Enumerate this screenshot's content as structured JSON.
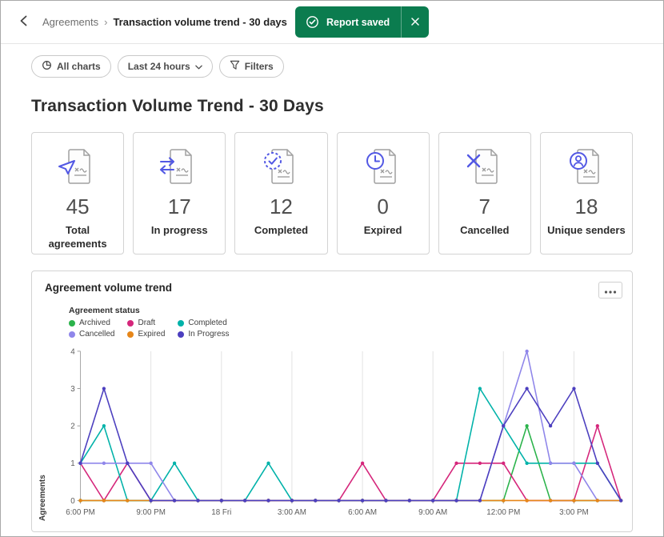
{
  "header": {
    "breadcrumb": {
      "parent": "Agreements",
      "separator": "›",
      "current": "Transaction volume trend - 30 days"
    },
    "toast": {
      "label": "Report saved"
    }
  },
  "toolbar": {
    "all_charts": "All charts",
    "time_range": "Last 24 hours",
    "filters": "Filters"
  },
  "page": {
    "title": "Transaction Volume Trend - 30 Days"
  },
  "stats": [
    {
      "value": "45",
      "label": "Total agreements",
      "icon": "send-document-icon"
    },
    {
      "value": "17",
      "label": "In progress",
      "icon": "transfer-document-icon"
    },
    {
      "value": "12",
      "label": "Completed",
      "icon": "check-document-icon"
    },
    {
      "value": "0",
      "label": "Expired",
      "icon": "clock-document-icon"
    },
    {
      "value": "7",
      "label": "Cancelled",
      "icon": "cancel-document-icon"
    },
    {
      "value": "18",
      "label": "Unique senders",
      "icon": "sender-document-icon"
    }
  ],
  "chart_card": {
    "title": "Agreement volume trend"
  },
  "colors": {
    "accent_indigo": "#5258e4",
    "toast_green": "#0b7c4f",
    "border_grey": "#d3d3d3"
  },
  "chart_data": {
    "type": "line",
    "title": "Agreement volume trend",
    "legend_title": "Agreement status",
    "ylabel": "Agreements",
    "ylim": [
      0,
      4
    ],
    "yticks": [
      0,
      1,
      2,
      3,
      4
    ],
    "x_description": "hourly points from 6:00 PM to 5:00 PM next day",
    "tick_indices": [
      0,
      3,
      6,
      9,
      12,
      15,
      18,
      21
    ],
    "tick_labels": [
      "6:00 PM",
      "9:00 PM",
      "18 Fri",
      "3:00 AM",
      "6:00 AM",
      "9:00 AM",
      "12:00 PM",
      "3:00 PM"
    ],
    "series": [
      {
        "name": "Archived",
        "color": "#2bb34b",
        "values": [
          0,
          0,
          0,
          0,
          0,
          0,
          0,
          0,
          0,
          0,
          0,
          0,
          0,
          0,
          0,
          0,
          0,
          0,
          0,
          2,
          0,
          0,
          0,
          0
        ]
      },
      {
        "name": "Draft",
        "color": "#d5267b",
        "values": [
          1,
          0,
          1,
          0,
          0,
          0,
          0,
          0,
          0,
          0,
          0,
          0,
          1,
          0,
          0,
          0,
          1,
          1,
          1,
          0,
          0,
          0,
          2,
          0
        ]
      },
      {
        "name": "Completed",
        "color": "#00b2a9",
        "values": [
          1,
          2,
          0,
          0,
          1,
          0,
          0,
          0,
          1,
          0,
          0,
          0,
          0,
          0,
          0,
          0,
          0,
          3,
          2,
          1,
          1,
          1,
          1,
          0
        ]
      },
      {
        "name": "Cancelled",
        "color": "#8f86ea",
        "values": [
          1,
          1,
          1,
          1,
          0,
          0,
          0,
          0,
          0,
          0,
          0,
          0,
          0,
          0,
          0,
          0,
          0,
          0,
          2,
          4,
          1,
          1,
          0,
          0
        ]
      },
      {
        "name": "Expired",
        "color": "#e68619",
        "values": [
          0,
          0,
          0,
          0,
          0,
          0,
          0,
          0,
          0,
          0,
          0,
          0,
          0,
          0,
          0,
          0,
          0,
          0,
          0,
          0,
          0,
          0,
          0,
          0
        ]
      },
      {
        "name": "In Progress",
        "color": "#4c3fbf",
        "values": [
          1,
          3,
          1,
          0,
          0,
          0,
          0,
          0,
          0,
          0,
          0,
          0,
          0,
          0,
          0,
          0,
          0,
          0,
          2,
          3,
          2,
          3,
          1,
          0
        ]
      }
    ]
  }
}
